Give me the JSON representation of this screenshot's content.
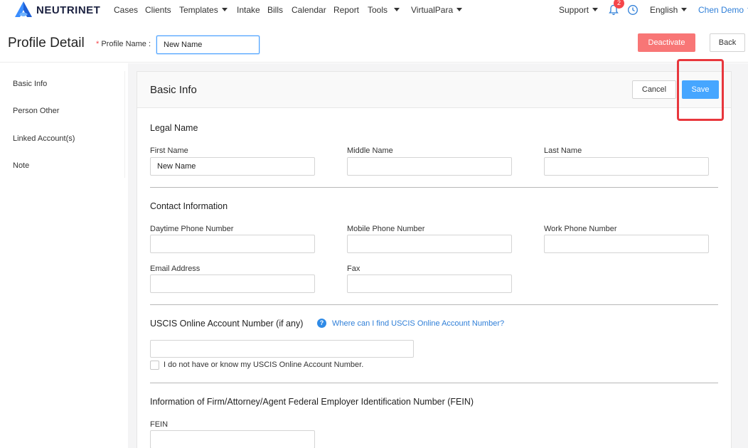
{
  "nav": {
    "brand": "NEUTRINET",
    "items": [
      {
        "label": "Cases"
      },
      {
        "label": "Clients"
      },
      {
        "label": "Templates"
      },
      {
        "label": "Intake"
      },
      {
        "label": "Bills"
      },
      {
        "label": "Calendar"
      },
      {
        "label": "Report"
      },
      {
        "label": "Tools"
      },
      {
        "label": "VirtualPara"
      }
    ],
    "support": "Support",
    "notification_count": "2",
    "language": "English",
    "user": "Chen Demo"
  },
  "header": {
    "title": "Profile Detail",
    "required_mark": "*",
    "profile_name_label": "Profile Name :",
    "profile_name_value": "New Name",
    "deactivate_label": "Deactivate",
    "back_label": "Back"
  },
  "sidebar": {
    "items": [
      {
        "label": "Basic Info"
      },
      {
        "label": "Person Other"
      },
      {
        "label": "Linked Account(s)"
      },
      {
        "label": "Note"
      }
    ]
  },
  "panel": {
    "title": "Basic Info",
    "cancel_label": "Cancel",
    "save_label": "Save"
  },
  "legal_name": {
    "title": "Legal Name",
    "first_label": "First Name",
    "first_value": "New Name",
    "middle_label": "Middle Name",
    "middle_value": "",
    "last_label": "Last Name",
    "last_value": ""
  },
  "contact": {
    "title": "Contact Information",
    "daytime_label": "Daytime Phone Number",
    "mobile_label": "Mobile Phone Number",
    "work_label": "Work Phone Number",
    "email_label": "Email Address",
    "fax_label": "Fax"
  },
  "uscis": {
    "title": "USCIS Online Account Number (if any)",
    "help_icon": "?",
    "help_link": "Where can I find USCIS Online Account Number?",
    "value": "",
    "checkbox_label": "I do not have or know my USCIS Online Account Number.",
    "checkbox_checked": false
  },
  "fein": {
    "title": "Information of Firm/Attorney/Agent Federal Employer Identification Number (FEIN)",
    "label": "FEIN",
    "value": ""
  },
  "colors": {
    "accent": "#46a6ff",
    "danger": "#f87676",
    "highlight": "#e8373d",
    "link": "#2f7fd8"
  }
}
